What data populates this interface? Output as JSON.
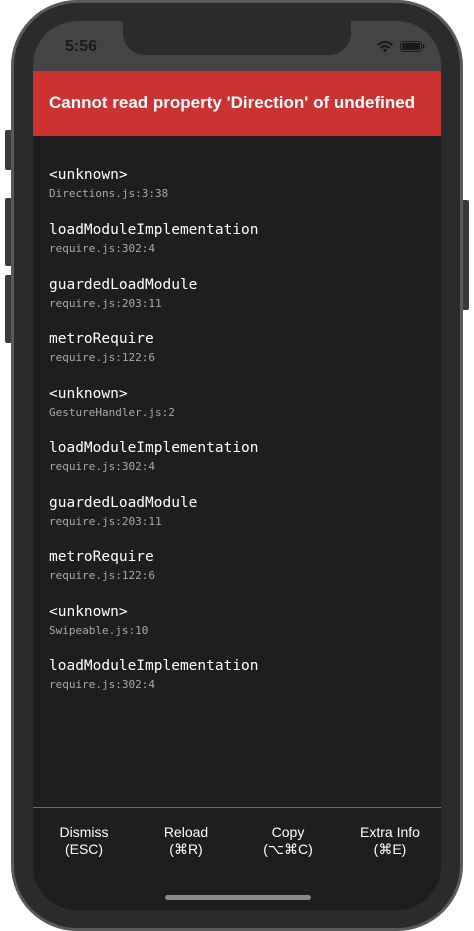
{
  "status_bar": {
    "time": "5:56",
    "icons": [
      "wifi-icon",
      "battery-icon"
    ]
  },
  "error": {
    "title": "Cannot read property 'Direction' of undefined",
    "color": "#cc3232"
  },
  "stack": [
    {
      "method": "<unknown>",
      "location": "Directions.js:3:38"
    },
    {
      "method": "loadModuleImplementation",
      "location": "require.js:302:4"
    },
    {
      "method": "guardedLoadModule",
      "location": "require.js:203:11"
    },
    {
      "method": "metroRequire",
      "location": "require.js:122:6"
    },
    {
      "method": "<unknown>",
      "location": "GestureHandler.js:2"
    },
    {
      "method": "loadModuleImplementation",
      "location": "require.js:302:4"
    },
    {
      "method": "guardedLoadModule",
      "location": "require.js:203:11"
    },
    {
      "method": "metroRequire",
      "location": "require.js:122:6"
    },
    {
      "method": "<unknown>",
      "location": "Swipeable.js:10"
    },
    {
      "method": "loadModuleImplementation",
      "location": "require.js:302:4"
    }
  ],
  "toolbar": {
    "dismiss": {
      "label": "Dismiss",
      "shortcut": "(ESC)"
    },
    "reload": {
      "label": "Reload",
      "shortcut": "(⌘R)"
    },
    "copy": {
      "label": "Copy",
      "shortcut": "(⌥⌘C)"
    },
    "extra_info": {
      "label": "Extra Info",
      "shortcut": "(⌘E)"
    }
  }
}
